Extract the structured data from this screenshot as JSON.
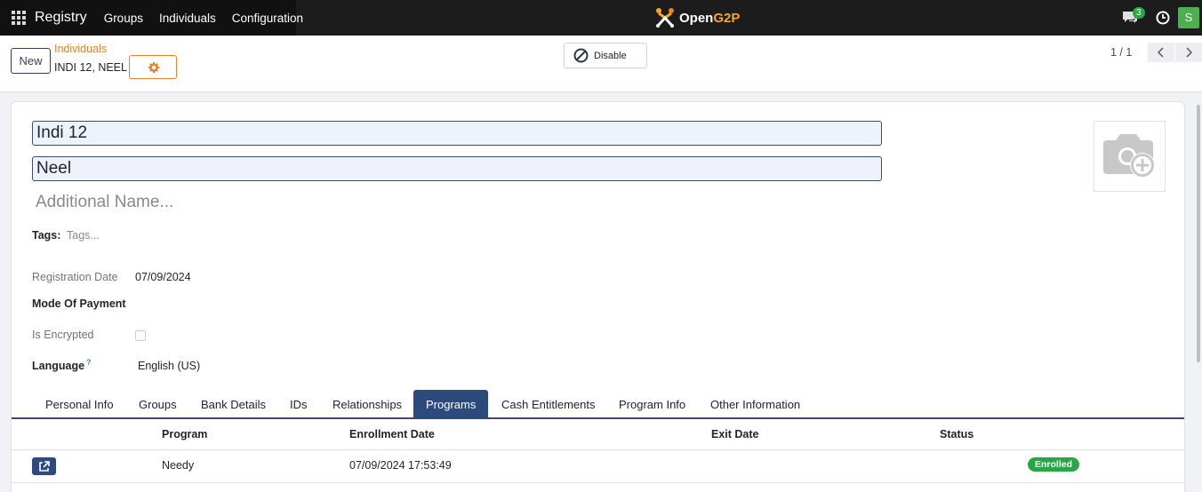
{
  "navbar": {
    "app_name": "Registry",
    "menu": [
      "Groups",
      "Individuals",
      "Configuration"
    ],
    "logo_text_a": "Open",
    "logo_text_b": "G2P",
    "chat_count": "3",
    "user_initial": "S"
  },
  "control": {
    "new_label": "New",
    "breadcrumb_parent": "Individuals",
    "breadcrumb_current": "INDI 12, NEEL",
    "disable_label": "Disable",
    "pager": "1 / 1"
  },
  "form": {
    "family_name": "Indi 12",
    "given_name": "Neel",
    "additional_name_placeholder": "Additional Name...",
    "tags_label": "Tags:",
    "tags_placeholder": "Tags...",
    "registration_date_label": "Registration Date",
    "registration_date": "07/09/2024",
    "mode_of_payment_label": "Mode Of Payment",
    "is_encrypted_label": "Is Encrypted",
    "language_label": "Language",
    "language_help": "?",
    "language": "English (US)"
  },
  "tabs": [
    "Personal Info",
    "Groups",
    "Bank Details",
    "IDs",
    "Relationships",
    "Programs",
    "Cash Entitlements",
    "Program Info",
    "Other Information"
  ],
  "active_tab": "Programs",
  "programs_table": {
    "columns": [
      "Program",
      "Enrollment Date",
      "Exit Date",
      "Status"
    ],
    "rows": [
      {
        "program": "Needy",
        "enrollment_date": "07/09/2024 17:53:49",
        "exit_date": "",
        "status": "Enrolled"
      }
    ]
  },
  "colors": {
    "navbar": "#1c1c1c",
    "accent_orange": "#e8812a",
    "primary": "#2d4a7d",
    "success": "#28a745"
  }
}
